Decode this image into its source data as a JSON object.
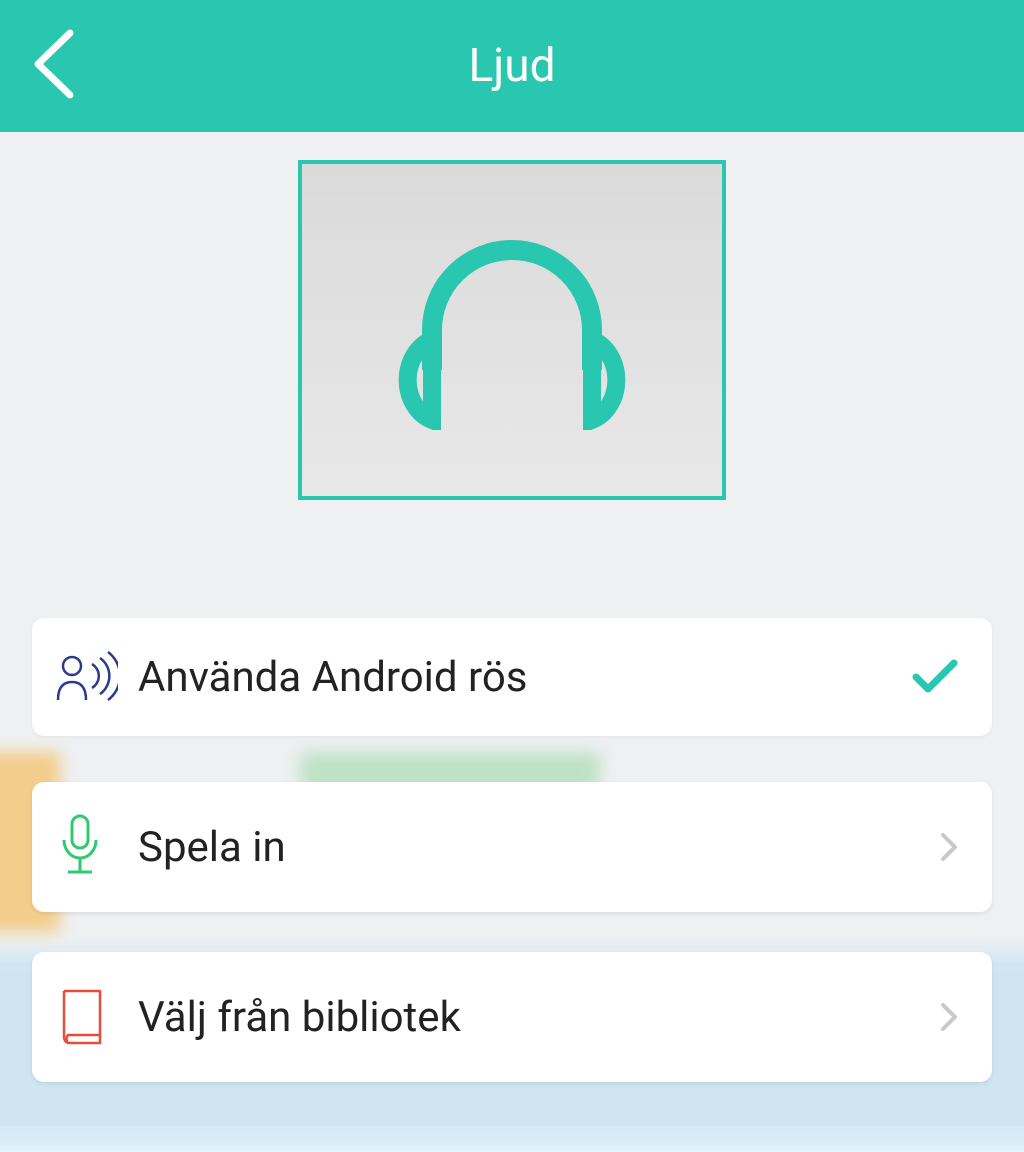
{
  "header": {
    "title": "Ljud"
  },
  "options": {
    "use_voice": {
      "label": "Använda Android rös"
    },
    "record": {
      "label": "Spela in"
    },
    "library": {
      "label": "Välj från bibliotek"
    }
  },
  "colors": {
    "accent": "#29c7b0",
    "voice_icon": "#2b3a8f",
    "mic_icon": "#2fc96f",
    "book_icon": "#e74c3c",
    "chevron": "#c9c9c9"
  }
}
